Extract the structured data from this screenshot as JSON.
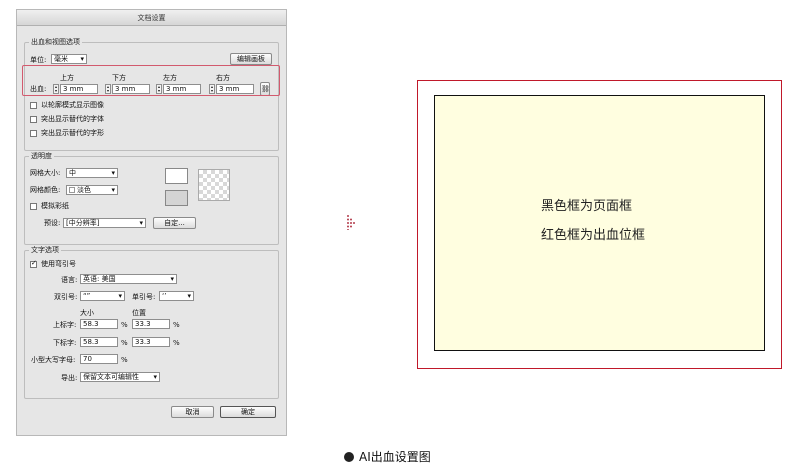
{
  "dialog": {
    "title": "文档设置",
    "bleed_group": {
      "legend": "出血和视图选项",
      "unit_label": "单位:",
      "unit_value": "毫米",
      "edit_artboard": "编辑画板",
      "bleed_label": "出血:",
      "fields": [
        {
          "label": "上方",
          "value": "3 mm"
        },
        {
          "label": "下方",
          "value": "3 mm"
        },
        {
          "label": "左方",
          "value": "3 mm"
        },
        {
          "label": "右方",
          "value": "3 mm"
        }
      ],
      "checkboxes": [
        "以轮廓模式显示图像",
        "突出显示替代的字体",
        "突出显示替代的字形"
      ]
    },
    "transparency_group": {
      "legend": "透明度",
      "grid_size_label": "网格大小:",
      "grid_size_value": "中",
      "grid_color_label": "网格颜色:",
      "grid_color_value": "淡色",
      "simulate_paper": "模拟彩纸",
      "preset_label": "预设:",
      "preset_value": "[中分辨率]",
      "custom_button": "自定..."
    },
    "type_group": {
      "legend": "文字选项",
      "use_typographers_quotes": "使用弯引号",
      "language_label": "语言:",
      "language_value": "英语: 美国",
      "double_quotes_label": "双引号:",
      "double_quotes_value": "“”",
      "single_quotes_label": "单引号:",
      "single_quotes_value": "‘’",
      "size_header": "大小",
      "position_header": "位置",
      "superscript_label": "上标字:",
      "superscript_size": "58.3",
      "superscript_position": "33.3",
      "subscript_label": "下标字:",
      "subscript_size": "58.3",
      "subscript_position": "33.3",
      "percent": "%",
      "small_caps_label": "小型大写字母:",
      "small_caps_value": "70",
      "export_label": "导出:",
      "export_value": "保留文本可编辑性"
    },
    "cancel_button": "取消",
    "ok_button": "确定"
  },
  "diagram": {
    "label_black": "黑色框为页面框",
    "label_red": "红色框为出血位框",
    "colors": {
      "bleed_frame": "#c0182a",
      "page_frame": "#111111",
      "page_fill": "#fffee0"
    }
  },
  "caption": "AI出血设置图"
}
